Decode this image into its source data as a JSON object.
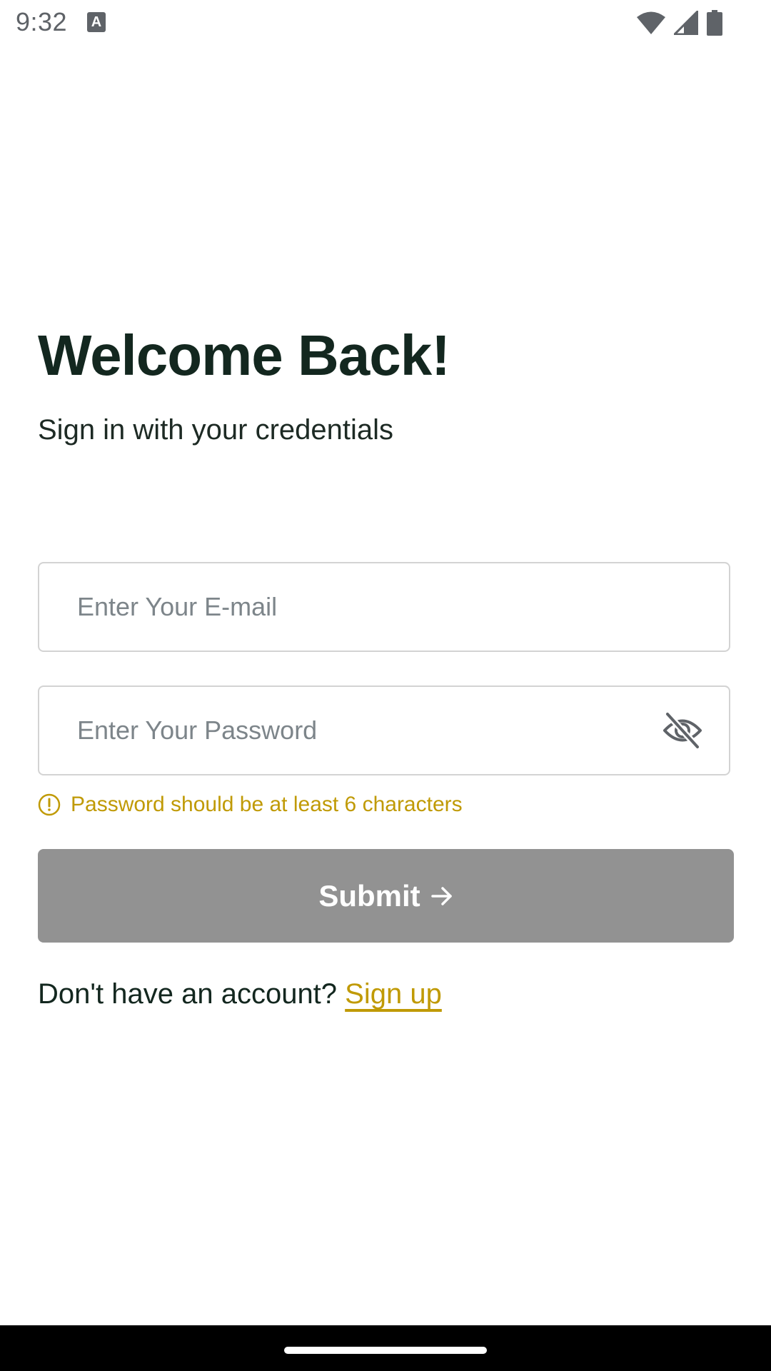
{
  "status_bar": {
    "time": "9:32",
    "notification_icon": "keyboard-a-icon",
    "notification_letter": "A",
    "icons": [
      "wifi-icon",
      "cellular-signal-icon",
      "battery-icon"
    ]
  },
  "login": {
    "title": "Welcome Back!",
    "subtitle": "Sign in with your credentials",
    "email": {
      "placeholder": "Enter Your E-mail",
      "value": ""
    },
    "password": {
      "placeholder": "Enter Your Password",
      "value": "",
      "toggle_icon": "eye-off-icon"
    },
    "validation_error": "Password should be at least 6 characters",
    "submit_label": "Submit",
    "signup_prompt": "Don't have an account?",
    "signup_link": "Sign up"
  },
  "colors": {
    "title": "#13271f",
    "accent_warning": "#c09a05",
    "button_disabled": "#929292",
    "field_border": "#d3d3d3",
    "placeholder": "#7d858a"
  }
}
